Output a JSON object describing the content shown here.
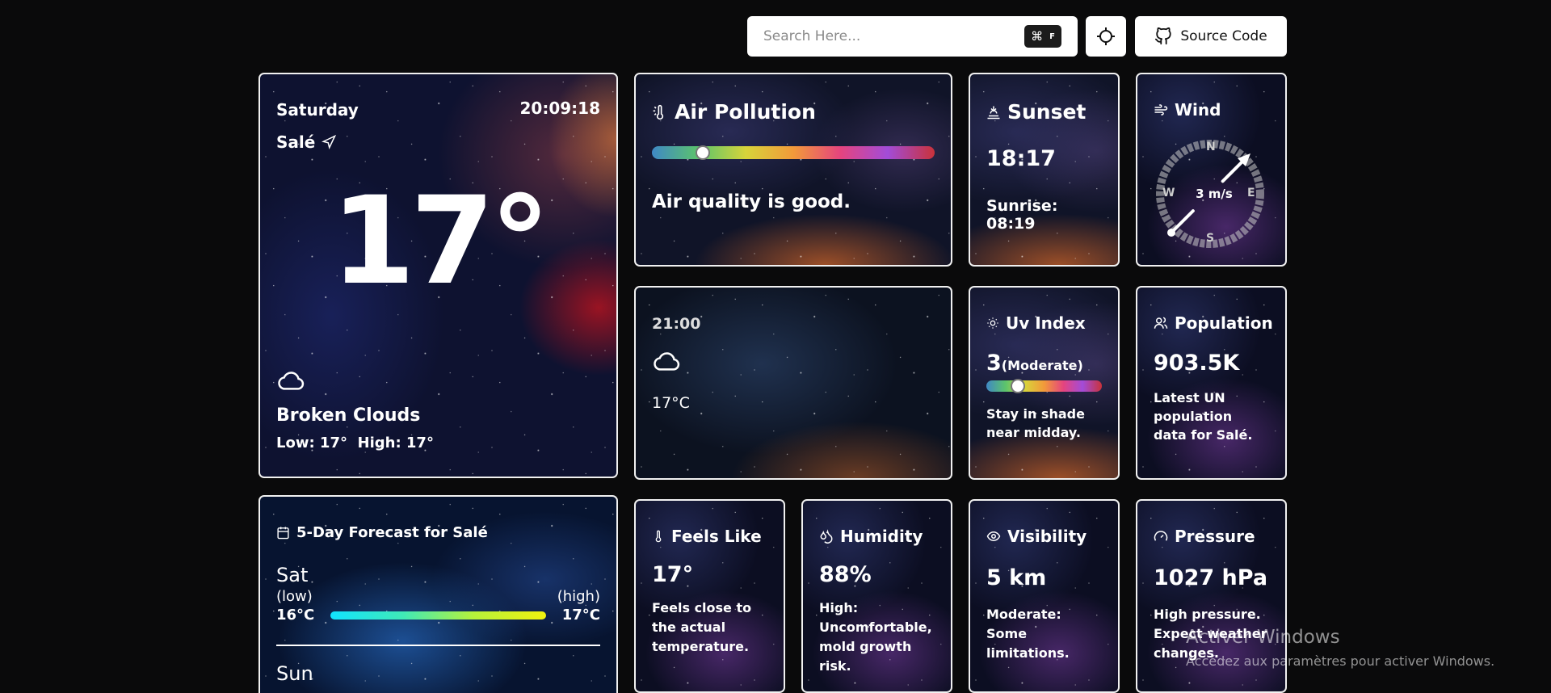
{
  "search": {
    "placeholder": "Search Here...",
    "shortcut_key1": "⌘",
    "shortcut_key2": "F"
  },
  "toolbar": {
    "source_code_label": "Source Code"
  },
  "current": {
    "day": "Saturday",
    "time": "20:09:18",
    "city": "Salé",
    "temperature": "17°",
    "condition": "Broken Clouds",
    "low_high": "Low: 17°  High: 17°"
  },
  "air_pollution": {
    "title": "Air Pollution",
    "level_fraction": 0.18,
    "message": "Air quality is good."
  },
  "sunset": {
    "title": "Sunset",
    "time": "18:17",
    "sunrise": "Sunrise: 08:19"
  },
  "wind": {
    "title": "Wind",
    "speed": "3 m/s",
    "north": "N",
    "east": "E",
    "south": "S",
    "west": "W",
    "direction_deg": 45
  },
  "hourly": {
    "time": "21:00",
    "temperature": "17°C"
  },
  "uv": {
    "title": "Uv Index",
    "value": "3",
    "label": "(Moderate)",
    "level_fraction": 0.27,
    "advice": "Stay in shade near midday."
  },
  "population": {
    "title": "Population",
    "value": "903.5K",
    "note": "Latest UN population data for Salé."
  },
  "forecast": {
    "title": "5-Day Forecast for Salé",
    "days": [
      {
        "day": "Sat",
        "low_label": "(low)",
        "high_label": "(high)",
        "low": "16°C",
        "high": "17°C"
      },
      {
        "day": "Sun"
      }
    ]
  },
  "feels_like": {
    "title": "Feels Like",
    "value": "17°",
    "note": "Feels close to the actual temperature."
  },
  "humidity": {
    "title": "Humidity",
    "value": "88%",
    "note": "High: Uncomfortable, mold growth risk."
  },
  "visibility": {
    "title": "Visibility",
    "value": "5 km",
    "note": "Moderate: Some limitations."
  },
  "pressure": {
    "title": "Pressure",
    "value": "1027 hPa",
    "note": "High pressure. Expect weather changes."
  },
  "os_watermark": {
    "line1": "Activer Windows",
    "line2": "Accédez aux paramètres pour activer Windows."
  },
  "colors": {
    "card_border": "#f1f1f1",
    "page_bg": "#0a0a0b",
    "range_start": "#11e3ff",
    "range_end": "#f1f20e"
  }
}
